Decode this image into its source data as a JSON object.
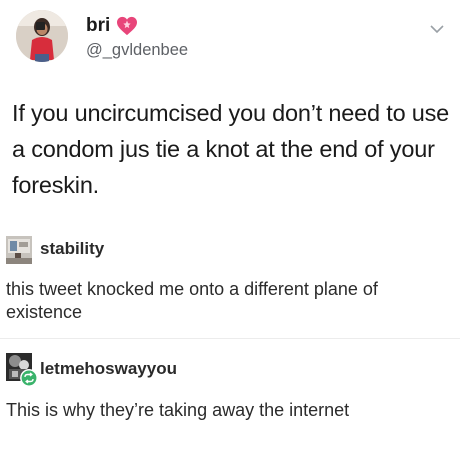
{
  "tweet": {
    "display_name": "bri",
    "name_emoji": "heart-icon",
    "handle": "@_gvldenbee",
    "text": "If you uncircumcised you don’t need to use a condom jus tie a knot at the end of your foreskin.",
    "menu_icon": "chevron-down-icon"
  },
  "comments": [
    {
      "username": "stability",
      "text": "this tweet knocked me onto a different plane of existence",
      "avatar_icon": "avatar-image"
    },
    {
      "username": "letmehoswayyou",
      "text": "This is why they’re taking away the internet",
      "avatar_icon": "avatar-image",
      "badge_icon": "repost-badge-icon"
    }
  ],
  "colors": {
    "background": "#ffffff",
    "text": "#1a1a1a",
    "handle": "#5e6166",
    "heart": "#e8457a",
    "badge": "#3ab36b"
  }
}
